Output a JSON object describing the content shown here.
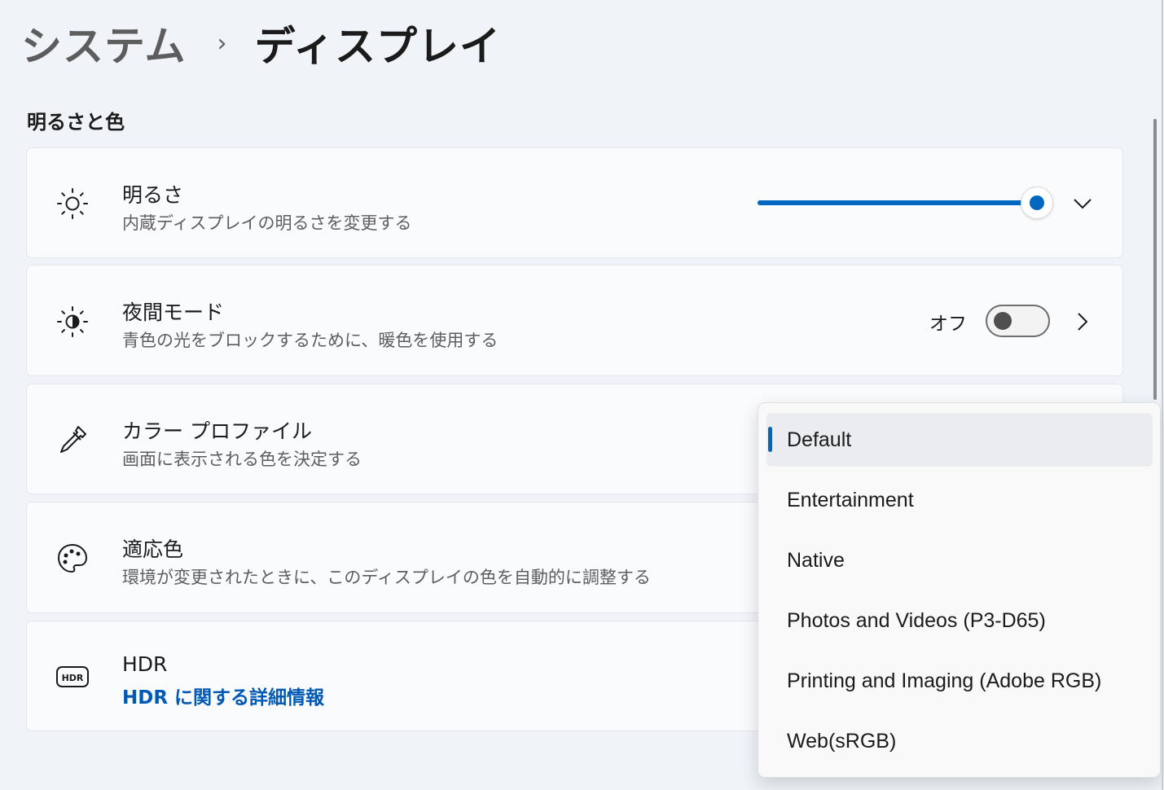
{
  "breadcrumb": {
    "parent": "システム",
    "separator": "›",
    "current": "ディスプレイ"
  },
  "section": {
    "title": "明るさと色"
  },
  "settings": {
    "brightness": {
      "title": "明るさ",
      "subtitle": "内蔵ディスプレイの明るさを変更する",
      "icon": "sun-icon",
      "slider_value_percent": 100
    },
    "night_mode": {
      "title": "夜間モード",
      "subtitle": "青色の光をブロックするために、暖色を使用する",
      "icon": "night-light-icon",
      "toggle_label": "オフ",
      "toggle_on": false
    },
    "color_profile": {
      "title": "カラー プロファイル",
      "subtitle": "画面に表示される色を決定する",
      "icon": "eyedropper-icon"
    },
    "adaptive_color": {
      "title": "適応色",
      "subtitle": "環境が変更されたときに、このディスプレイの色を自動的に調整する",
      "icon": "palette-icon"
    },
    "hdr": {
      "title": "HDR",
      "link": "HDR に関する詳細情報",
      "icon": "hdr-icon"
    }
  },
  "color_profile_dropdown": {
    "selected": "Default",
    "options": [
      "Default",
      "Entertainment",
      "Native",
      "Photos and Videos (P3-D65)",
      "Printing and Imaging (Adobe RGB)",
      "Web(sRGB)"
    ]
  },
  "colors": {
    "accent": "#0067c0",
    "link": "#0059b3",
    "background": "#f0f4f9",
    "card": "#fafbfd"
  }
}
